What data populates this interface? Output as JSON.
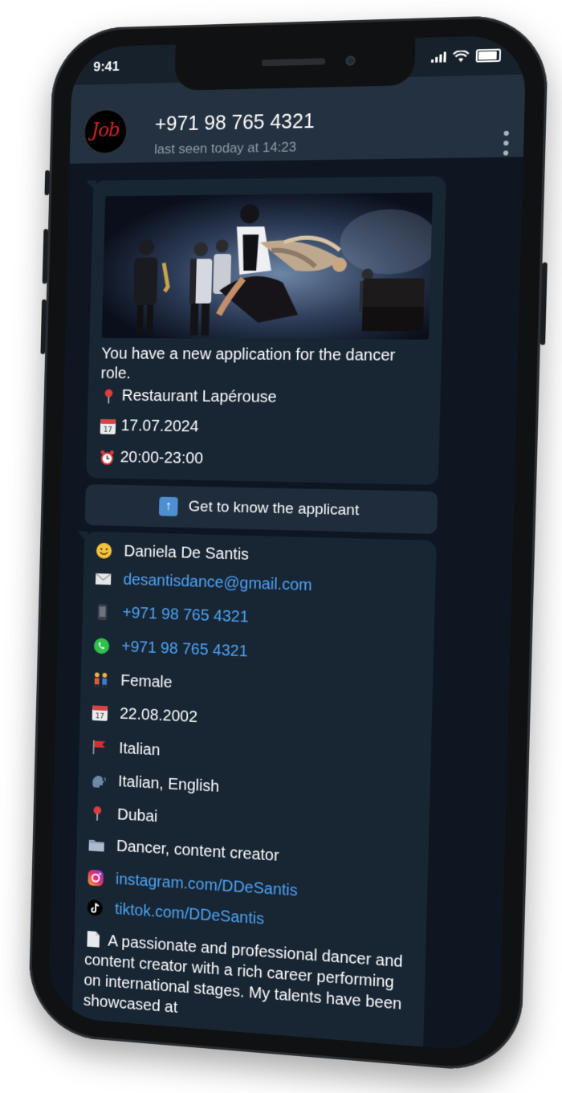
{
  "status": {
    "time": "9:41"
  },
  "header": {
    "avatar_text": "Job",
    "contact_name": "+971 98 765 4321",
    "last_seen": "last seen today at 14:23"
  },
  "job_message": {
    "text": "You have a new application for the dancer role.",
    "location": "Restaurant Lapérouse",
    "date": "17.07.2024",
    "time": "20:00-23:00"
  },
  "button": {
    "label": "Get to know the applicant"
  },
  "applicant": {
    "name": "Daniela De Santis",
    "email": "desantisdance@gmail.com",
    "phone": "+971 98 765 4321",
    "whatsapp": "+971 98 765 4321",
    "gender": "Female",
    "birthdate": "22.08.2002",
    "nationality": "Italian",
    "languages": "Italian, English",
    "city": "Dubai",
    "profession": "Dancer, content creator",
    "instagram": "instagram.com/DDeSantis",
    "tiktok": "tiktok.com/DDeSantis",
    "bio": "A passionate and professional dancer and content creator with a rich career performing on international stages. My talents have been showcased at"
  }
}
